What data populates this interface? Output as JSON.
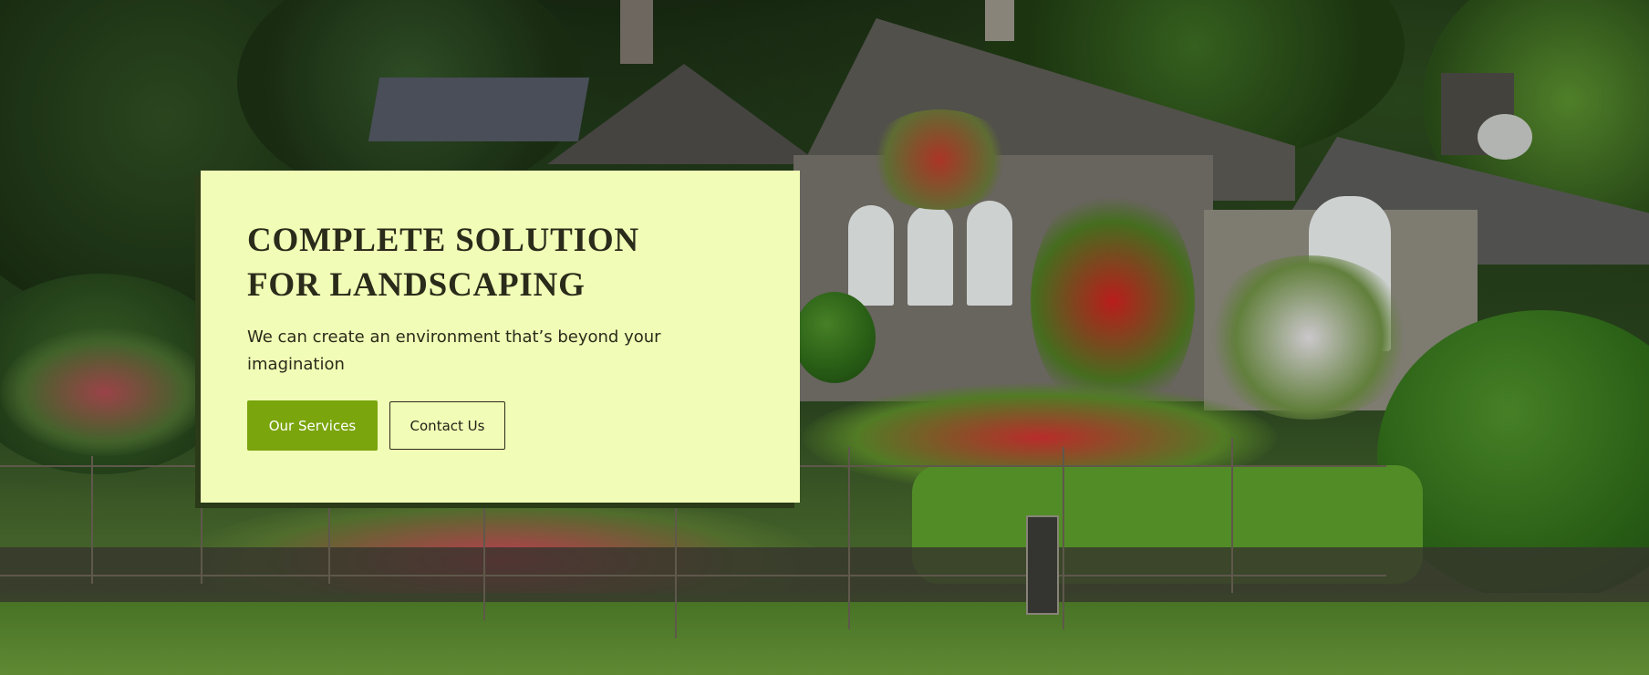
{
  "hero": {
    "title_line1": "COMPLETE SOLUTION",
    "title_line2": "FOR LANDSCAPING",
    "description": "We can create an environment that’s beyond your imagination",
    "primary_button_label": "Our Services",
    "secondary_button_label": "Contact Us"
  },
  "colors": {
    "card_background": "#f1fdb6",
    "primary_button": "#7aa50d",
    "text": "#2a2b1a"
  }
}
